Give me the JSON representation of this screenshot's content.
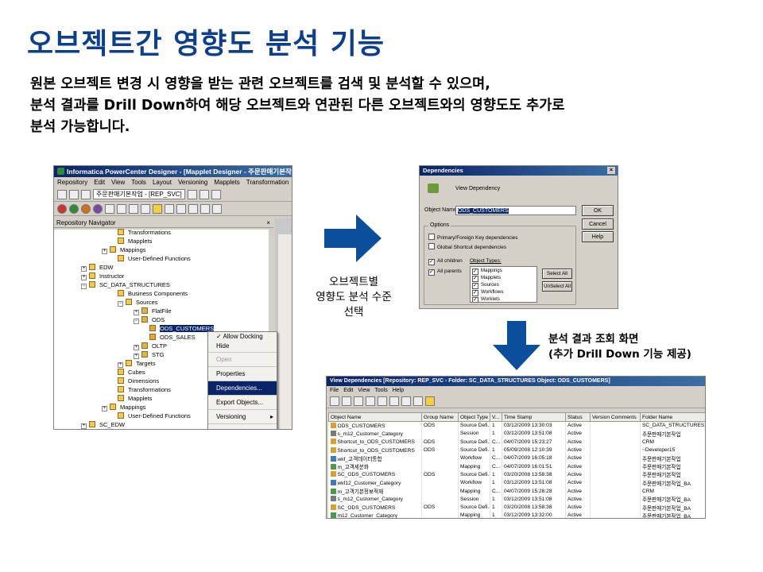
{
  "slide": {
    "title": "오브젝트간 영향도 분석 기능",
    "desc_line1": "원본 오브젝트 변경 시 영향을 받는 관련 오브젝트를 검색 및 분석할 수 있으며,",
    "desc_line2": "분석 결과를 Drill Down하여 해당 오브젝트와 연관된 다른 오브젝트와의 영향도도 추가로",
    "desc_line3": "분석 가능합니다.",
    "arrow1_label_line1": "오브젝트별",
    "arrow1_label_line2": "영향도 분석 수준",
    "arrow1_label_line3": "선택",
    "arrow2_label_line1": "분석 결과 조회 화면",
    "arrow2_label_line2": "(추가 Drill Down 기능 제공)",
    "accent_color": "#0d3f8c",
    "arrow_color": "#0b4f9c"
  },
  "designer": {
    "title": "Informatica PowerCenter Designer - [Mapplet Designer - 주문판매기본작",
    "menu": [
      "Repository",
      "Edit",
      "View",
      "Tools",
      "Layout",
      "Versioning",
      "Mapplets",
      "Transformation"
    ],
    "folder_dropdown": "주문판매기본작업 - [REP_SVC]",
    "navigator_title": "Repository Navigator",
    "navigator_close": "×",
    "tree": [
      {
        "label": "Transformations",
        "kind": "folder"
      },
      {
        "label": "Mapplets",
        "kind": "folder"
      },
      {
        "label": "Mappings",
        "kind": "folder"
      },
      {
        "label": "User-Defined Functions",
        "kind": "folder"
      },
      {
        "label": "EDW",
        "kind": "repo"
      },
      {
        "label": "Instructor",
        "kind": "repo"
      },
      {
        "label": "SC_DATA_STRUCTURES",
        "kind": "repo"
      },
      {
        "label": "Business Components",
        "kind": "folder"
      },
      {
        "label": "Sources",
        "kind": "folder"
      },
      {
        "label": "FlatFile",
        "kind": "db"
      },
      {
        "label": "ODS",
        "kind": "db"
      },
      {
        "label": "ODS_CUSTOMERS",
        "kind": "table"
      },
      {
        "label": "ODS_SALES",
        "kind": "table"
      },
      {
        "label": "OLTP",
        "kind": "db"
      },
      {
        "label": "STG",
        "kind": "db"
      },
      {
        "label": "Targets",
        "kind": "folder"
      },
      {
        "label": "Cubes",
        "kind": "folder"
      },
      {
        "label": "Dimensions",
        "kind": "folder"
      },
      {
        "label": "Transformations",
        "kind": "folder"
      },
      {
        "label": "Mapplets",
        "kind": "folder"
      },
      {
        "label": "Mappings",
        "kind": "folder"
      },
      {
        "label": "User-Defined Functions",
        "kind": "folder"
      },
      {
        "label": "SC_EDW",
        "kind": "repo"
      }
    ],
    "context_menu": [
      "Allow Docking",
      "Hide",
      "Open",
      "Properties",
      "Dependencies...",
      "Export Objects...",
      "Versioning"
    ]
  },
  "dependencies_dialog": {
    "title": "Dependencies",
    "close": "×",
    "header_text": "View Dependency",
    "object_name_label": "Object Name:",
    "object_name_value": "ODS_CUSTOMERS",
    "ok": "OK",
    "cancel": "Cancel",
    "help": "Help",
    "options_label": "Options",
    "opt_primary": "Primary/Foreign Key dependencies",
    "opt_global": "Global Shortcut dependencies",
    "all_children": "All children",
    "all_parents": "All parents",
    "object_types_label": "Object Types:",
    "object_types": [
      "Mappings",
      "Mapplets",
      "Sources",
      "Workflows",
      "Worklets"
    ],
    "select_all": "Select All",
    "unselect_all": "UnSelect All"
  },
  "view_dependencies": {
    "title": "View Dependencies [Repository: REP_SVC - Folder: SC_DATA_STRUCTURES Object: ODS_CUSTOMERS]",
    "menu": [
      "File",
      "Edit",
      "View",
      "Tools",
      "Help"
    ],
    "columns": [
      "Object Name",
      "Group Name",
      "Object Type",
      "V...",
      "Time Stamp",
      "Status",
      "Version Comments",
      "Folder Name"
    ],
    "rows": [
      [
        "ODS_CUSTOMERS",
        "ODS",
        "Source Defi...",
        "1",
        "03/12/2009 13:30:03",
        "Active",
        "",
        "SC_DATA_STRUCTURES"
      ],
      [
        "s_m12_Customer_Category",
        "",
        "Session",
        "1",
        "03/12/2009 13:51:08",
        "Active",
        "",
        "주문판매기본작업"
      ],
      [
        "Shortcut_to_ODS_CUSTOMERS",
        "ODS",
        "Source Defi...",
        "C...",
        "04/07/2009 15:23:27",
        "Active",
        "",
        "CRM"
      ],
      [
        "Shortcut_to_ODS_CUSTOMERS",
        "ODS",
        "Source Defi...",
        "1",
        "05/09/2008 12:10:39",
        "Active",
        "",
        "~Developer15"
      ],
      [
        "wkf_고객데이터통합",
        "",
        "Workflow",
        "C...",
        "04/07/2009 16:05:18",
        "Active",
        "",
        "주문판매기본작업"
      ],
      [
        "m_고객세분화",
        "",
        "Mapping",
        "C...",
        "04/07/2009 16:01:51",
        "Active",
        "",
        "주문판매기본작업"
      ],
      [
        "SC_ODS_CUSTOMERS",
        "ODS",
        "Source Defi...",
        "1",
        "03/20/2008 13:58:38",
        "Active",
        "",
        "주문판매기본작업"
      ],
      [
        "wkf12_Customer_Category",
        "",
        "Workflow",
        "1",
        "03/12/2009 13:51:08",
        "Active",
        "",
        "주문판매기본작업_BA"
      ],
      [
        "m_고객기본정보적재",
        "",
        "Mapping",
        "C...",
        "04/07/2009 15:28:28",
        "Active",
        "",
        "CRM"
      ],
      [
        "s_m12_Customer_Category",
        "",
        "Session",
        "1",
        "03/12/2009 13:51:08",
        "Active",
        "",
        "주문판매기본작업_BA"
      ],
      [
        "SC_ODS_CUSTOMERS",
        "ODS",
        "Source Defi...",
        "1",
        "03/20/2008 13:58:38",
        "Active",
        "",
        "주문판매기본작업_BA"
      ],
      [
        "m12_Customer_Category",
        "",
        "Mapping",
        "1",
        "03/12/2009 13:32:00",
        "Active",
        "",
        "주문판매기본작업_BA"
      ]
    ]
  }
}
